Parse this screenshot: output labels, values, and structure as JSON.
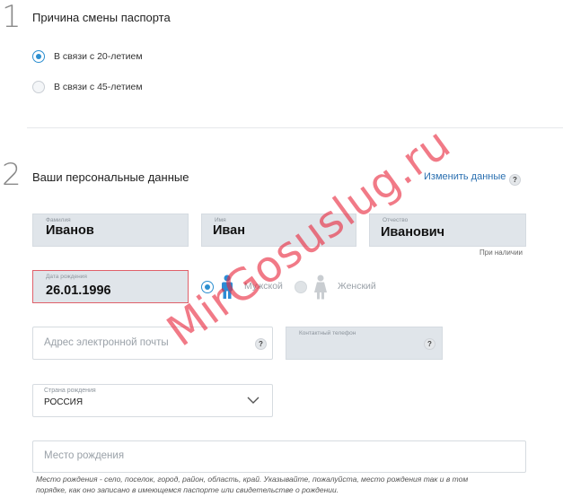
{
  "section1": {
    "number": "1",
    "title": "Причина смены паспорта",
    "options": [
      {
        "label": "В связи с 20-летием",
        "selected": true
      },
      {
        "label": "В связи с 45-летием",
        "selected": false
      }
    ]
  },
  "section2": {
    "number": "2",
    "title": "Ваши персональные данные",
    "edit_link": "Изменить данные",
    "help_mark": "?"
  },
  "personal": {
    "last_name": {
      "label": "Фамилия",
      "value": "Иванов"
    },
    "first_name": {
      "label": "Имя",
      "value": "Иван"
    },
    "patronymic": {
      "label": "Отчество",
      "value": "Иванович",
      "note": "При наличии"
    },
    "birth_date": {
      "label": "Дата рождения",
      "value": "26.01.1996"
    },
    "gender": {
      "male_label": "Мужской",
      "female_label": "Женский",
      "selected": "male"
    },
    "email": {
      "placeholder": "Адрес электронной почты",
      "help": "?"
    },
    "phone": {
      "label": "Контактный телефон",
      "help": "?"
    },
    "birth_country": {
      "label": "Страна рождения",
      "value": "РОССИЯ"
    },
    "birth_place": {
      "placeholder": "Место рождения",
      "hint": "Место рождения - село, поселок, город, район, область, край. Указывайте, пожалуйста, место рождения так и в том порядке, как оно записано в имеющемся паспорте или свидетельстве о рождении."
    }
  },
  "watermark": "MirGosuslug.ru",
  "colors": {
    "accent": "#2c8fd0",
    "link": "#2a6fb0",
    "error_border": "#e0606a",
    "filled_field": "#e0e5ea",
    "watermark": "#e8283e",
    "male_icon": "#2d8bd4",
    "female_icon": "#c9cdd1"
  }
}
